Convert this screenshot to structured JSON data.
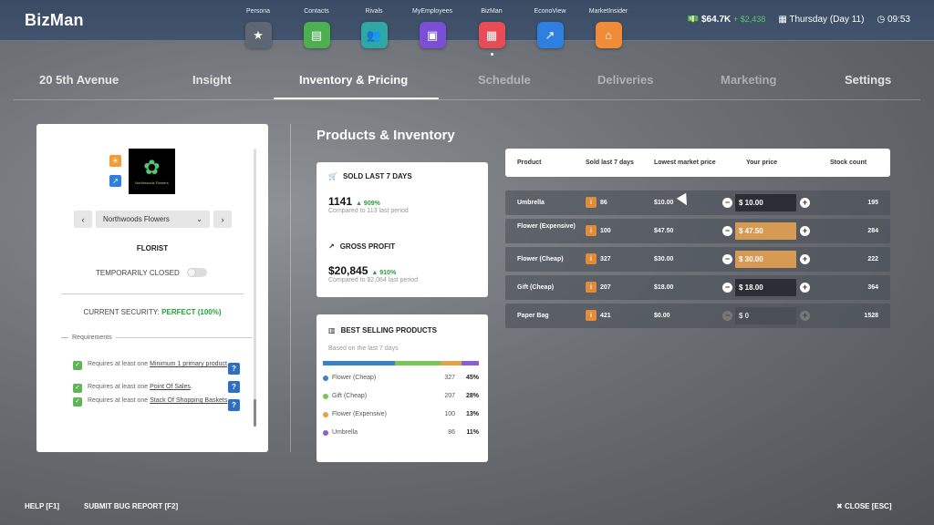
{
  "app": {
    "brand": "BizMan"
  },
  "apps": [
    {
      "label": "Persona",
      "icon": "star-icon",
      "color": "#5d6673",
      "glyph": "★"
    },
    {
      "label": "Contacts",
      "icon": "chat-icon",
      "color": "#4caf50",
      "glyph": "▤"
    },
    {
      "label": "Rivals",
      "icon": "people-icon",
      "color": "#2fa7a4",
      "glyph": "👥"
    },
    {
      "label": "MyEmployees",
      "icon": "badge-icon",
      "color": "#7a4fd6",
      "glyph": "▣"
    },
    {
      "label": "BizMan",
      "icon": "store-icon",
      "color": "#e74c57",
      "glyph": "▦"
    },
    {
      "label": "EconoView",
      "icon": "trend-icon",
      "color": "#2f7fe0",
      "glyph": "↗"
    },
    {
      "label": "MarketInsider",
      "icon": "market-icon",
      "color": "#f08b38",
      "glyph": "⌂"
    }
  ],
  "stats": {
    "money": "$64.7K",
    "money_delta": "+ $2,438",
    "day": "Thursday (Day 11)",
    "time": "09:53"
  },
  "tabs": [
    "20 5th Avenue",
    "Insight",
    "Inventory & Pricing",
    "Schedule",
    "Deliveries",
    "Marketing",
    "Settings"
  ],
  "business": {
    "logo_text": "Northwoods Flowers",
    "selected": "Northwoods Flowers",
    "category": "FLORIST",
    "closed_label": "TEMPORARILY CLOSED",
    "security_label": "CURRENT SECURITY:",
    "security_value": "PERFECT (100%)",
    "req_heading": "Requirements",
    "req_prefix": "Requires at least one",
    "requirements": [
      "Minimum 1 primary product",
      "Point Of Sales",
      "Stack Of Shopping Baskets"
    ]
  },
  "section_title": "Products & Inventory",
  "sold": {
    "title": "SOLD LAST 7 DAYS",
    "value": "1141",
    "delta": "909%",
    "compare": "Compared to 113 last period"
  },
  "profit": {
    "title": "GROSS PROFIT",
    "value": "$20,845",
    "delta": "910%",
    "compare": "Compared to $2,064 last period"
  },
  "best": {
    "title": "BEST SELLING PRODUCTS",
    "subtitle": "Based on the last 7 days",
    "items": [
      {
        "name": "Flower (Cheap)",
        "count": "327",
        "pct": "45%",
        "color": "#3b82c4",
        "share": 45
      },
      {
        "name": "Gift (Cheap)",
        "count": "207",
        "pct": "28%",
        "color": "#7cc35a",
        "share": 28
      },
      {
        "name": "Flower (Expensive)",
        "count": "100",
        "pct": "13%",
        "color": "#e2a24a",
        "share": 13
      },
      {
        "name": "Umbrella",
        "count": "86",
        "pct": "11%",
        "color": "#8a5fd0",
        "share": 11
      }
    ]
  },
  "table": {
    "headers": [
      "Product",
      "Sold last 7 days",
      "Lowest market price",
      "Your price",
      "Stock count"
    ],
    "rows": [
      {
        "product": "Umbrella",
        "sold": "86",
        "lowest": "$10.00",
        "price": "$ 10.00",
        "stock": "195",
        "state": "normal"
      },
      {
        "product": "Flower (Expensive)",
        "sold": "100",
        "lowest": "$47.50",
        "price": "$ 47.50",
        "stock": "284",
        "state": "warn"
      },
      {
        "product": "Flower (Cheap)",
        "sold": "327",
        "lowest": "$30.00",
        "price": "$ 30.00",
        "stock": "222",
        "state": "warn"
      },
      {
        "product": "Gift (Cheap)",
        "sold": "207",
        "lowest": "$18.00",
        "price": "$ 18.00",
        "stock": "364",
        "state": "normal"
      },
      {
        "product": "Paper Bag",
        "sold": "421",
        "lowest": "$0.00",
        "price": "$ 0",
        "stock": "1528",
        "state": "off"
      }
    ]
  },
  "footer": {
    "help": "HELP [F1]",
    "bug": "SUBMIT BUG REPORT [F2]",
    "close": "CLOSE [ESC]"
  }
}
